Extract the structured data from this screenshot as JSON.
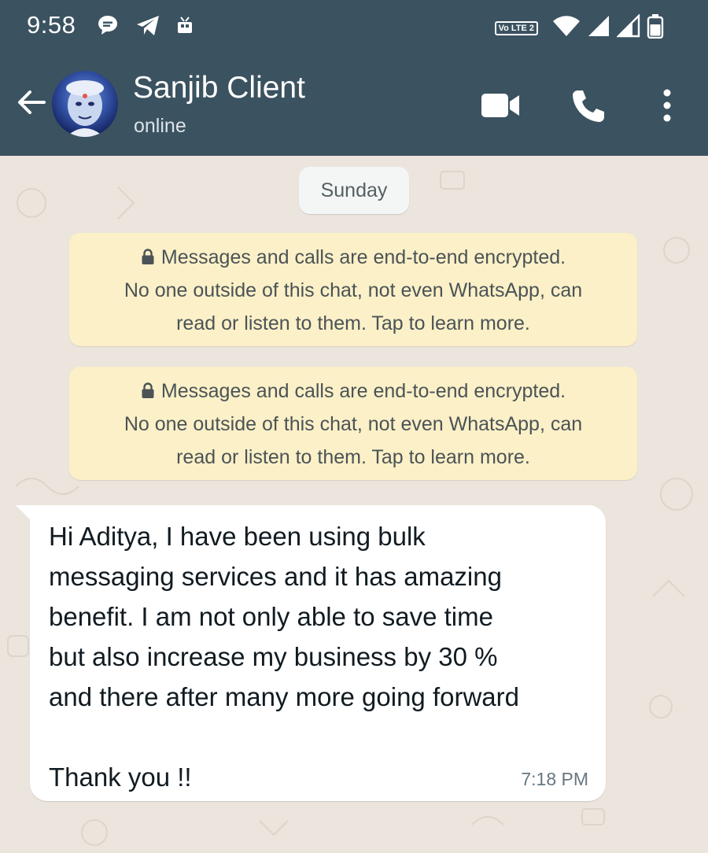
{
  "status_bar": {
    "time": "9:58",
    "left_icons": [
      "chat-bubble-icon",
      "telegram-icon",
      "tv-icon"
    ],
    "right_icons": [
      "volte-icon",
      "wifi-icon",
      "signal-icon",
      "signal-icon",
      "battery-icon"
    ],
    "volte_label": "Vo LTE 2"
  },
  "header": {
    "contact_name": "Sanjib Client",
    "contact_status": "online",
    "actions": [
      "video-call-icon",
      "phone-icon",
      "more-vert-icon"
    ]
  },
  "chat": {
    "date_chip": "Sunday",
    "notices": [
      {
        "lines": [
          "Messages and calls are end-to-end encrypted.",
          "No one outside of this chat, not even WhatsApp, can",
          "read or listen to them. Tap to learn more."
        ]
      },
      {
        "lines": [
          "Messages and calls are end-to-end encrypted.",
          "No one outside of this chat, not even WhatsApp, can",
          "read or listen to them. Tap to learn more."
        ]
      }
    ],
    "message": {
      "text": "Hi Aditya, I have been using bulk\nmessaging services and it has amazing\nbenefit. I am not only  able to save time\nbut also increase my business by 30 %\nand there after many more going forward\n\nThank you !!",
      "time": "7:18 PM"
    }
  },
  "colors": {
    "header_bg": "#3b5260",
    "chat_bg": "#ece5dd",
    "notice_bg": "#fbf0c7",
    "bubble_bg": "#ffffff"
  }
}
